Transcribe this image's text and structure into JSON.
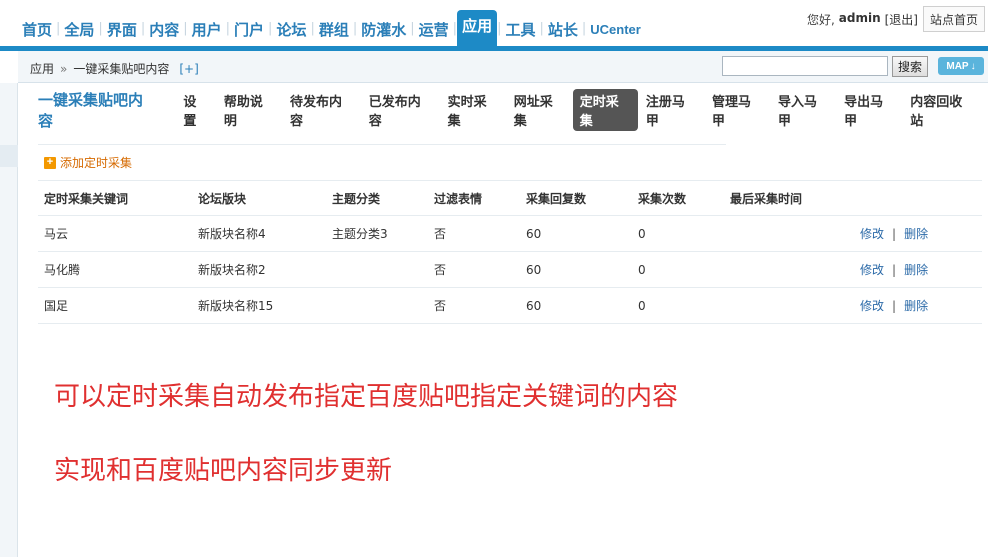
{
  "topnav": {
    "items": [
      "首页",
      "全局",
      "界面",
      "内容",
      "用户",
      "门户",
      "论坛",
      "群组",
      "防灌水",
      "运营",
      "应用",
      "工具",
      "站长",
      "UCenter"
    ],
    "active_index": 10,
    "greeting": "您好,",
    "username": "admin",
    "logout": "[退出]",
    "site_home": "站点首页"
  },
  "breadcrumb": {
    "root": "应用",
    "separator": "»",
    "current": "一键采集贴吧内容",
    "add": "[+]"
  },
  "search": {
    "button": "搜索",
    "map": "MAP"
  },
  "plugin": {
    "title": "一键采集贴吧内容",
    "tabs": [
      "设置",
      "帮助说明",
      "待发布内容",
      "已发布内容",
      "实时采集",
      "网址采集",
      "定时采集",
      "注册马甲",
      "管理马甲",
      "导入马甲",
      "导出马甲",
      "内容回收站"
    ],
    "active_tab": "定时采集"
  },
  "add_link": "添加定时采集",
  "table": {
    "headers": [
      "定时采集关键词",
      "论坛版块",
      "主题分类",
      "过滤表情",
      "采集回复数",
      "采集次数",
      "最后采集时间"
    ],
    "rows": [
      {
        "keyword": "马云",
        "forum": "新版块名称4",
        "category": "主题分类3",
        "filter": "否",
        "replies": "60",
        "count": "0",
        "last": ""
      },
      {
        "keyword": "马化腾",
        "forum": "新版块名称2",
        "category": "",
        "filter": "否",
        "replies": "60",
        "count": "0",
        "last": ""
      },
      {
        "keyword": "国足",
        "forum": "新版块名称15",
        "category": "",
        "filter": "否",
        "replies": "60",
        "count": "0",
        "last": ""
      }
    ],
    "edit": "修改",
    "op_sep": "|",
    "delete": "删除"
  },
  "annotation": {
    "line1": "可以定时采集自动发布指定百度贴吧指定关键词的内容",
    "line2": "实现和百度贴吧内容同步更新"
  }
}
